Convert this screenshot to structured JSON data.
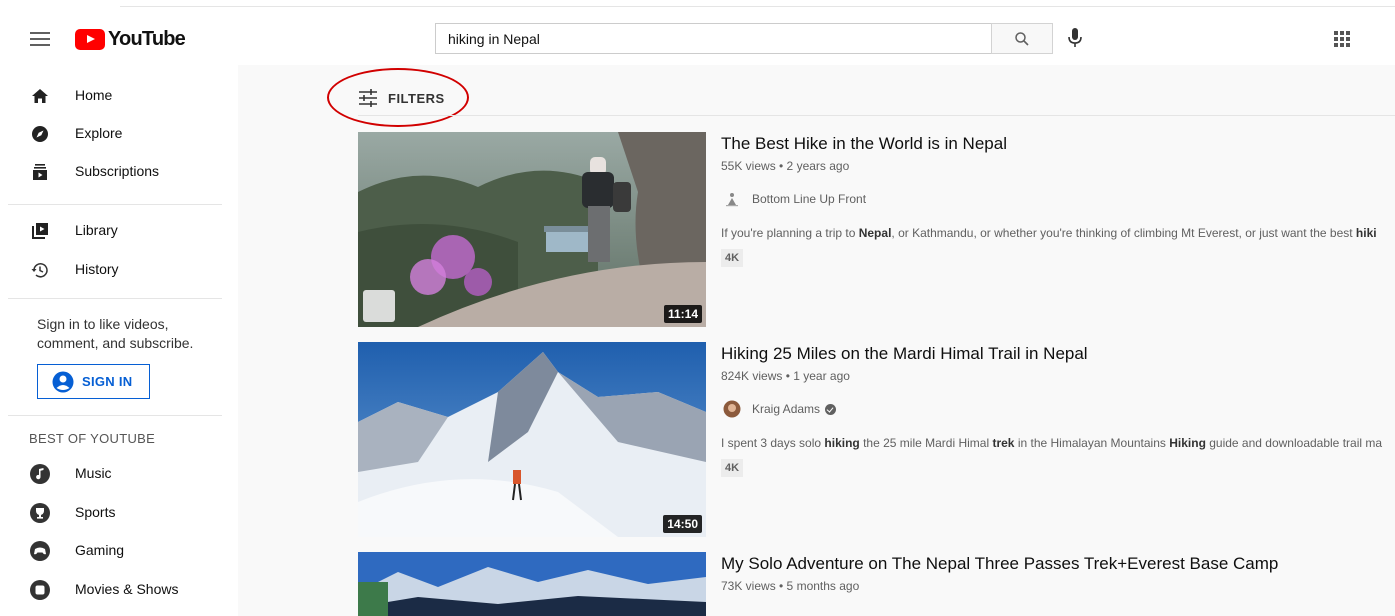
{
  "header": {
    "logo_text": "YouTube",
    "search_value": "hiking in Nepal"
  },
  "sidebar": {
    "items": [
      {
        "label": "Home",
        "icon": "home-icon"
      },
      {
        "label": "Explore",
        "icon": "compass-icon"
      },
      {
        "label": "Subscriptions",
        "icon": "subscriptions-icon"
      },
      {
        "label": "Library",
        "icon": "library-icon"
      },
      {
        "label": "History",
        "icon": "history-icon"
      }
    ],
    "signin_text": "Sign in to like videos, comment, and subscribe.",
    "signin_button": "SIGN IN",
    "best_of_title": "BEST OF YOUTUBE",
    "best_of_items": [
      {
        "label": "Music",
        "icon": "music-icon"
      },
      {
        "label": "Sports",
        "icon": "trophy-icon"
      },
      {
        "label": "Gaming",
        "icon": "gamepad-icon"
      },
      {
        "label": "Movies & Shows",
        "icon": "film-icon"
      }
    ]
  },
  "main": {
    "filters_label": "FILTERS",
    "videos": [
      {
        "title": "The Best Hike in the World is in Nepal",
        "meta": "55K views • 2 years ago",
        "channel": "Bottom Line Up Front",
        "desc_1": "If you're planning a trip to ",
        "desc_b1": "Nepal",
        "desc_2": ", or Kathmandu, or whether you're thinking of climbing Mt Everest, or just want the best ",
        "desc_b2": "hiki",
        "badge": "4K",
        "duration": "11:14"
      },
      {
        "title": "Hiking 25 Miles on the Mardi Himal Trail in Nepal",
        "meta": "824K views • 1 year ago",
        "channel": "Kraig Adams",
        "desc_1": "I spent 3 days solo ",
        "desc_b1": "hiking",
        "desc_2": " the 25 mile Mardi Himal ",
        "desc_b2": "trek",
        "desc_3": " in the Himalayan Mountains ",
        "desc_b3": "Hiking",
        "desc_4": " guide and downloadable trail ma",
        "badge": "4K",
        "duration": "14:50"
      },
      {
        "title": "My Solo Adventure on The Nepal Three Passes Trek+Everest Base Camp",
        "meta": "73K views • 5 months ago"
      }
    ]
  },
  "colors": {
    "brand_red": "#ff0000",
    "link_blue": "#065fd4",
    "highlight_circle": "#d10000"
  }
}
